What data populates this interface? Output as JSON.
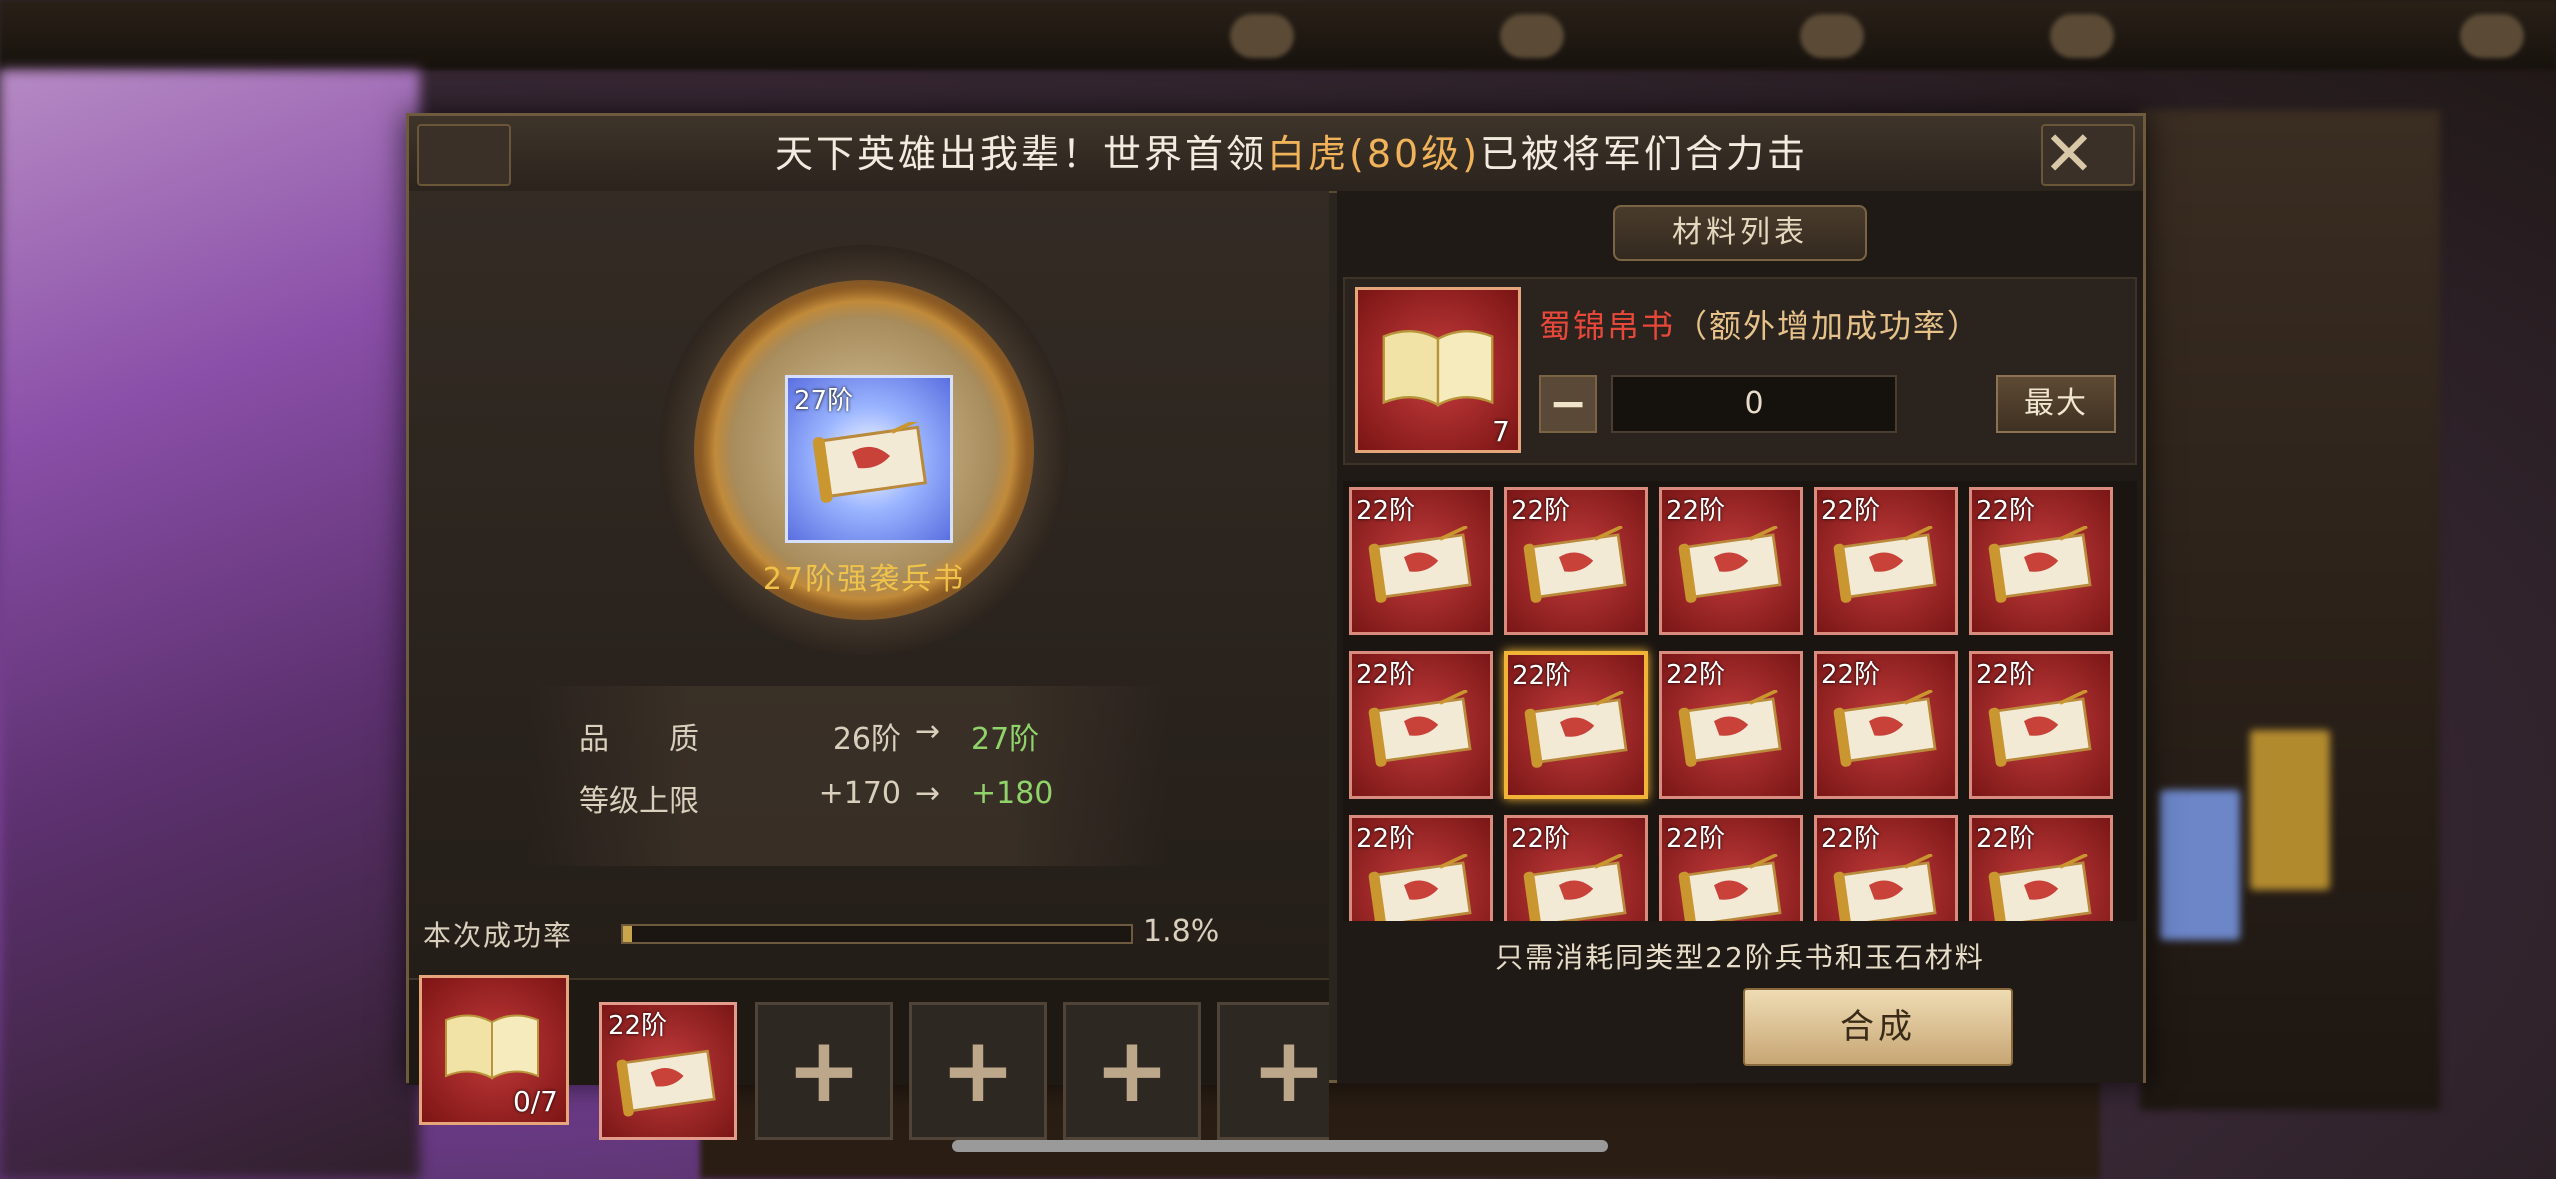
{
  "announcement": {
    "prefix": "天下英雄出我辈！世界首领",
    "highlight": "白虎(80级)",
    "suffix": "已被将军们合力击"
  },
  "item": {
    "tier": "27阶",
    "name": "27阶强袭兵书"
  },
  "stats": [
    {
      "label": "品　　质",
      "from": "26阶",
      "arrow": "→",
      "to": "27阶"
    },
    {
      "label": "等级上限",
      "from": "+170",
      "arrow": "→",
      "to": "+180"
    }
  ],
  "success_rate": {
    "label": "本次成功率",
    "value": "1.8%",
    "fraction": 0.018
  },
  "bottom_slots": {
    "book_count": "0/7",
    "scroll_tier": "22阶",
    "empty_plus": "+"
  },
  "materials": {
    "header": "材料列表",
    "name": "蜀锦帛书",
    "note": "（额外增加成功率）",
    "count": "7",
    "qty": "0",
    "minus": "−",
    "plus": "+",
    "max_label": "最大"
  },
  "grid": {
    "tier": "22阶",
    "selected_index": 6
  },
  "hint": "只需消耗同类型22阶兵书和玉石材料",
  "combine_label": "合成",
  "close_icon": "close-x-icon",
  "colors": {
    "highlight": "#f0b35a",
    "increase": "#8fd36a",
    "material_name": "#e8483a"
  }
}
